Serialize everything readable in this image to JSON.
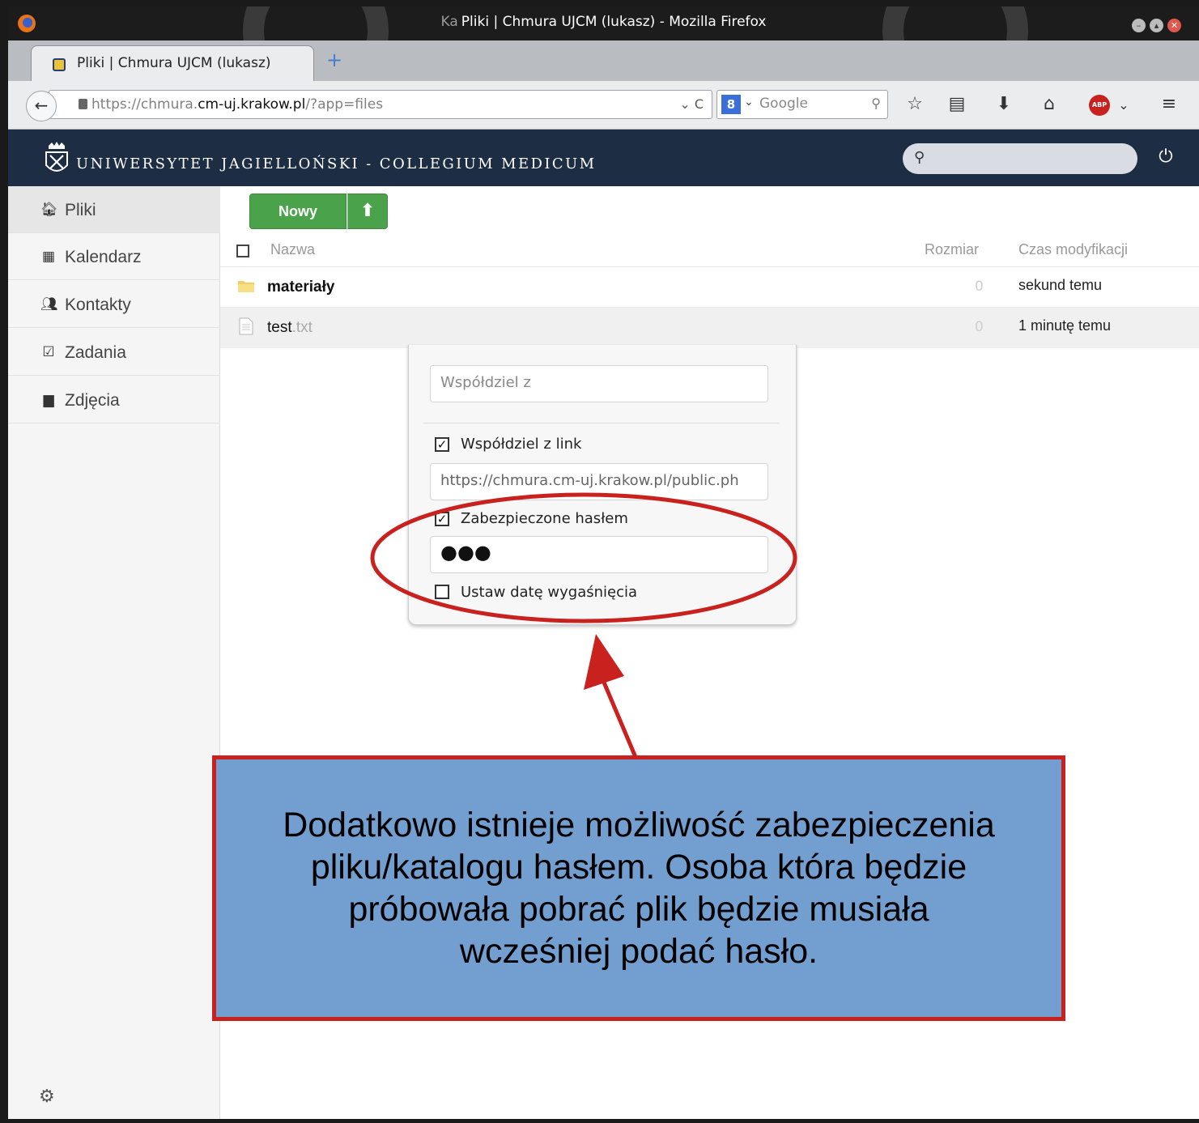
{
  "window": {
    "title_prefix": "Ka",
    "title": "Pliki | Chmura UJCM (lukasz) - Mozilla Firefox"
  },
  "tab": {
    "label": "Pliki | Chmura UJCM (lukasz)",
    "new_tab_symbol": "+"
  },
  "navbar": {
    "back_symbol": "←",
    "url_prefix": "https://chmura.",
    "url_domain": "cm-uj.krakow.pl",
    "url_suffix": "/?app=files",
    "url_controls": "⌄ C",
    "search_engine": "8",
    "search_placeholder": "Google",
    "icons": [
      "bookmark-star-icon",
      "reading-list-icon",
      "download-icon",
      "home-icon",
      "adblock-icon",
      "menu-icon"
    ],
    "abp_label": "ABP"
  },
  "header": {
    "university_name": "UNIWERSYTET JAGIELLOŃSKI - COLLEGIUM MEDICUM"
  },
  "sidebar": {
    "items": [
      {
        "label": "Pliki",
        "icon": "home-icon"
      },
      {
        "label": "Kalendarz",
        "icon": "calendar-icon"
      },
      {
        "label": "Kontakty",
        "icon": "contacts-icon"
      },
      {
        "label": "Zadania",
        "icon": "tasks-icon"
      },
      {
        "label": "Zdjęcia",
        "icon": "photos-icon"
      }
    ]
  },
  "toolbar": {
    "new_label": "Nowy",
    "upload_symbol": "🡅"
  },
  "files": {
    "columns": {
      "name": "Nazwa",
      "size": "Rozmiar",
      "modified": "Czas modyfikacji"
    },
    "rows": [
      {
        "name": "materiały",
        "ext": "",
        "size": "0",
        "modified": "sekund temu",
        "type": "folder"
      },
      {
        "name": "test",
        "ext": ".txt",
        "size": "0",
        "modified": "1 minutę temu",
        "type": "file"
      }
    ]
  },
  "share": {
    "share_with_placeholder": "Współdziel z",
    "share_link_label": "Współdziel z link",
    "share_link_checked": true,
    "link_value": "https://chmura.cm-uj.krakow.pl/public.ph",
    "password_protect_label": "Zabezpieczone hasłem",
    "password_protect_checked": true,
    "password_value": "●●●",
    "expire_label": "Ustaw datę wygaśnięcia",
    "expire_checked": false
  },
  "annotation": {
    "text": "Dodatkowo istnieje możliwość zabezpieczenia\npliku/katalogu hasłem. Osoba która będzie\npróbowała pobrać plik będzie musiała\nwcześniej podać hasło.",
    "border_color": "#c9211e",
    "fill_color": "#729fcf"
  }
}
